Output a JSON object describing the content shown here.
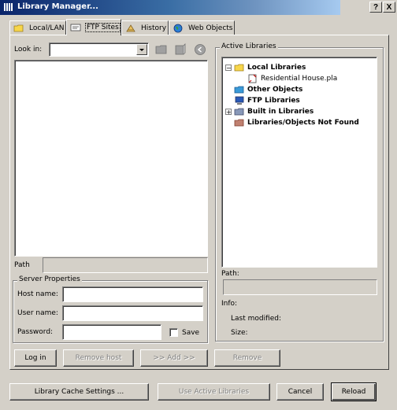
{
  "window": {
    "title": "Library Manager..."
  },
  "title_buttons": {
    "help": "?",
    "close": "X"
  },
  "tabs": [
    {
      "label": "Local/LAN"
    },
    {
      "label": "FTP Sites"
    },
    {
      "label": "History"
    },
    {
      "label": "Web Objects"
    }
  ],
  "left": {
    "look_in_label": "Look in:",
    "look_in_value": "",
    "path_label": "Path",
    "path_value": "",
    "server": {
      "title": "Server Properties",
      "host_label": "Host name:",
      "user_label": "User name:",
      "password_label": "Password:",
      "save_label": "Save",
      "save_checked": false
    },
    "buttons": {
      "login": "Log in",
      "remove_host": "Remove host",
      "add": ">> Add >>",
      "remove": "Remove"
    }
  },
  "right": {
    "title": "Active Libraries",
    "tree": {
      "local": "Local Libraries",
      "local_child": "Residential House.pla",
      "other": "Other Objects",
      "ftp": "FTP Libraries",
      "builtin": "Built in Libraries",
      "notfound": "Libraries/Objects Not Found"
    },
    "path_label": "Path:",
    "info_label": "Info:",
    "last_modified_label": "Last modified:",
    "size_label": "Size:"
  },
  "bottom": {
    "cache": "Library Cache Settings ...",
    "use_active": "Use Active Libraries",
    "cancel": "Cancel",
    "reload": "Reload"
  },
  "colors": {
    "title_start": "#0a246a",
    "title_end": "#a6caf0",
    "face": "#d4d0c8"
  }
}
